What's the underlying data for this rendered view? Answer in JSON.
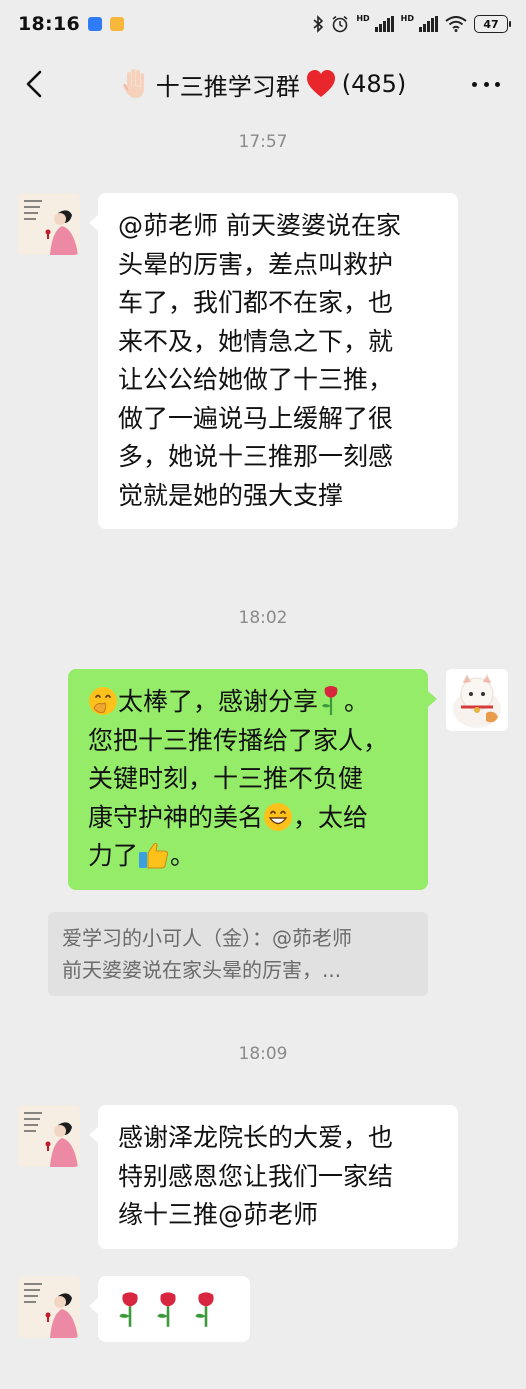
{
  "status_bar": {
    "time": "18:16",
    "battery": "47",
    "hd1": "HD",
    "hd2": "HD"
  },
  "nav": {
    "title": "十三推学习群",
    "count": "(485)",
    "title_emoji": "raised-hand-emoji",
    "heart_emoji": "red-heart-emoji"
  },
  "messages": [
    {
      "type": "timestamp",
      "text": "17:57"
    },
    {
      "type": "incoming",
      "lines": [
        "@茆老师  前天婆婆说在家",
        "头晕的厉害，差点叫救护",
        "车了，我们都不在家，也",
        "来不及，她情急之下，就",
        "让公公给她做了十三推，",
        "做了一遍说马上缓解了很",
        "多，她说十三推那一刻感",
        "觉就是她的强大支撑"
      ]
    },
    {
      "type": "timestamp",
      "text": "18:02"
    },
    {
      "type": "outgoing",
      "line1_text": "太棒了，感谢分享",
      "line1_tail": "。",
      "line2": "您把十三推传播给了家人，",
      "line3": "关键时刻，十三推不负健",
      "line4_text": "康守护神的美名",
      "line4_tail": "，太给",
      "line5_text": "力了",
      "line5_tail": "。"
    },
    {
      "type": "quote",
      "line1": "爱学习的小可人（金）：@茆老师",
      "line2": "前天婆婆说在家头晕的厉害，..."
    },
    {
      "type": "timestamp",
      "text": "18:09"
    },
    {
      "type": "incoming",
      "lines": [
        "感谢泽龙院长的大爱，也",
        "特别感恩您让我们一家结",
        "缘十三推@茆老师"
      ]
    },
    {
      "type": "incoming-emoji",
      "emoji": [
        "rose-emoji",
        "rose-emoji",
        "rose-emoji"
      ]
    }
  ],
  "colors": {
    "background": "#ededed",
    "incoming_bubble": "#ffffff",
    "outgoing_bubble": "#95ec69",
    "quote_bg": "#e1e1e1",
    "timestamp": "#8a8a8a"
  }
}
